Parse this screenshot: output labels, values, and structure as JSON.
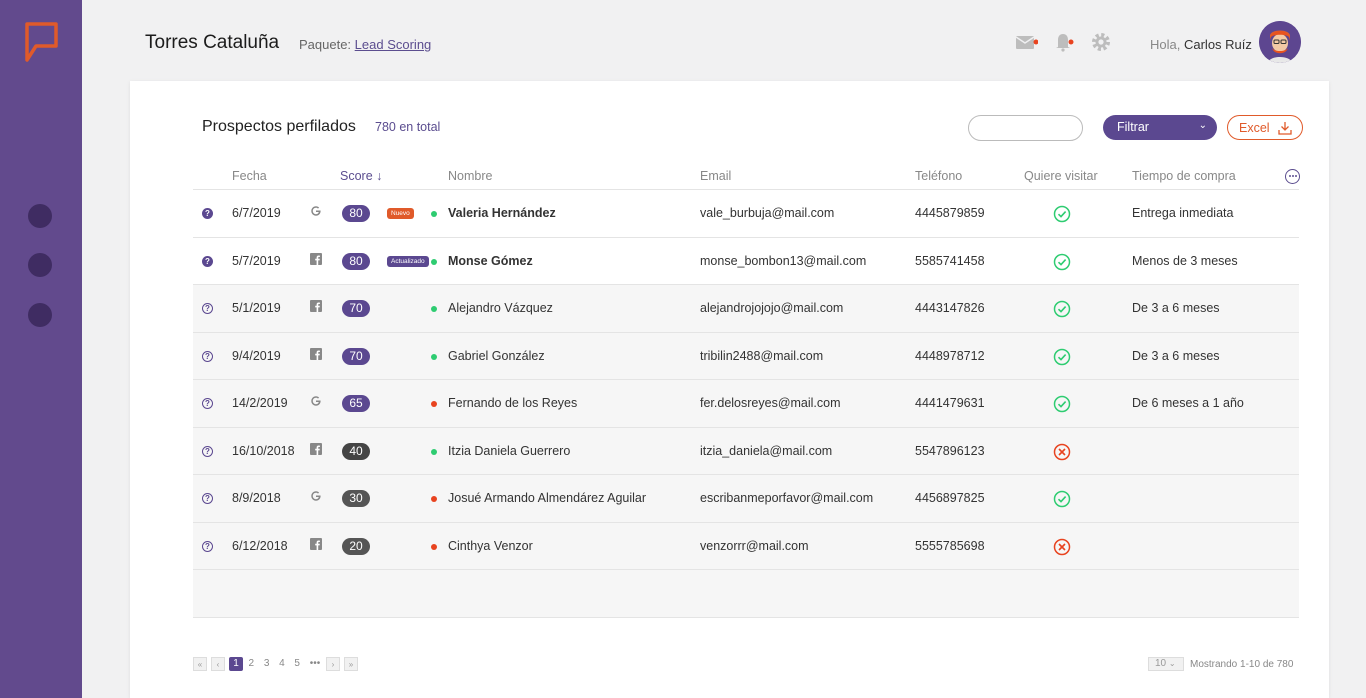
{
  "header": {
    "company": "Torres Cataluña",
    "package_label": "Paquete:",
    "package_link": "Lead Scoring",
    "greeting": "Hola,",
    "user_name": "Carlos Ruíz"
  },
  "card": {
    "title": "Prospectos perfilados",
    "total": "780 en total",
    "filter_label": "Filtrar",
    "excel_label": "Excel"
  },
  "columns": {
    "fecha": "Fecha",
    "score": "Score ↓",
    "nombre": "Nombre",
    "email": "Email",
    "telefono": "Teléfono",
    "visitar": "Quiere visitar",
    "tiempo": "Tiempo de compra"
  },
  "rows": [
    {
      "date": "6/7/2019",
      "source": "google",
      "score": "80",
      "tag": "Nuevo",
      "status": "green",
      "name": "Valeria Hernández",
      "email": "vale_burbuja@mail.com",
      "phone": "4445879859",
      "visit": "yes",
      "time": "Entrega inmediata"
    },
    {
      "date": "5/7/2019",
      "source": "facebook",
      "score": "80",
      "tag": "Actualizado",
      "status": "green",
      "name": "Monse Gómez",
      "email": "monse_bombon13@mail.com",
      "phone": "5585741458",
      "visit": "yes",
      "time": "Menos de 3 meses"
    },
    {
      "date": "5/1/2019",
      "source": "facebook",
      "score": "70",
      "tag": "",
      "status": "green",
      "name": "Alejandro Vázquez",
      "email": "alejandrojojojo@mail.com",
      "phone": "4443147826",
      "visit": "yes",
      "time": "De 3 a 6 meses"
    },
    {
      "date": "9/4/2019",
      "source": "facebook",
      "score": "70",
      "tag": "",
      "status": "green",
      "name": "Gabriel González",
      "email": "tribilin2488@mail.com",
      "phone": "4448978712",
      "visit": "yes",
      "time": "De 3 a 6 meses"
    },
    {
      "date": "14/2/2019",
      "source": "google",
      "score": "65",
      "tag": "",
      "status": "red",
      "name": "Fernando de los Reyes",
      "email": "fer.delosreyes@mail.com",
      "phone": "4441479631",
      "visit": "yes",
      "time": "De 6 meses a 1 año"
    },
    {
      "date": "16/10/2018",
      "source": "facebook",
      "score": "40",
      "tag": "",
      "status": "green",
      "name": "Itzia Daniela Guerrero",
      "email": "itzia_daniela@mail.com",
      "phone": "5547896123",
      "visit": "no",
      "time": ""
    },
    {
      "date": "8/9/2018",
      "source": "google",
      "score": "30",
      "tag": "",
      "status": "red",
      "name": "Josué Armando Almendárez Aguilar",
      "email": "escribanmeporfavor@mail.com",
      "phone": "4456897825",
      "visit": "yes",
      "time": ""
    },
    {
      "date": "6/12/2018",
      "source": "facebook",
      "score": "20",
      "tag": "",
      "status": "red",
      "name": "Cinthya Venzor",
      "email": "venzorrr@mail.com",
      "phone": "5555785698",
      "visit": "no",
      "time": ""
    }
  ],
  "pagination": {
    "pages": [
      "1",
      "2",
      "3",
      "4",
      "5"
    ],
    "current": "1",
    "ellipsis": "•••",
    "first": "«",
    "prev": "‹",
    "next": "›",
    "last": "»",
    "per_page": "10",
    "showing": "Mostrando 1-10 de 780"
  },
  "colors": {
    "sidebar": "#624a8d",
    "accent": "#5b4890",
    "orange": "#e05a2a",
    "green_status": "#2ecc71",
    "red_status": "#e8431f"
  }
}
